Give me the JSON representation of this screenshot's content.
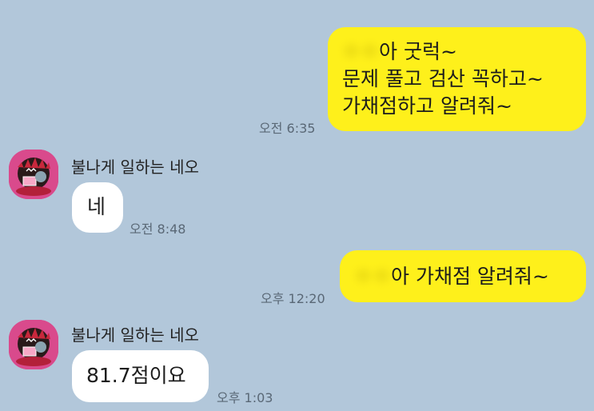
{
  "messages": [
    {
      "direction": "out",
      "lines": [
        {
          "blurred": "ㅇㅇ",
          "text": "아 굿럭~"
        },
        {
          "blurred": "",
          "text": "문제 풀고 검산 꼭하고~"
        },
        {
          "blurred": "",
          "text": "가채점하고 알려줘~"
        }
      ],
      "time": "오전 6:35"
    },
    {
      "direction": "in",
      "sender": "불나게 일하는 네오",
      "text": "네",
      "time": "오전 8:48"
    },
    {
      "direction": "out",
      "lines": [
        {
          "blurred": "ㅇㅇ",
          "text": "아 가채점 알려줘~"
        }
      ],
      "time": "오후 12:20"
    },
    {
      "direction": "in",
      "sender": "불나게 일하는 네오",
      "text": "81.7점이요",
      "time": "오후 1:03"
    }
  ],
  "colors": {
    "background": "#b2c7da",
    "outgoing_bubble": "#fef01b",
    "incoming_bubble": "#ffffff",
    "avatar": "#d94a8c"
  }
}
